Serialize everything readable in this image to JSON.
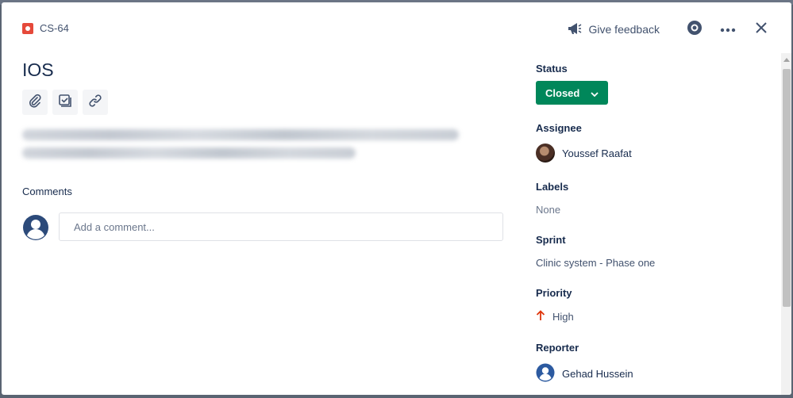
{
  "issue": {
    "key": "CS-64",
    "title": "IOS"
  },
  "header": {
    "feedback_label": "Give feedback"
  },
  "comments": {
    "label": "Comments",
    "placeholder": "Add a comment..."
  },
  "sidebar": {
    "status": {
      "label": "Status",
      "value": "Closed",
      "color": "#00875a"
    },
    "assignee": {
      "label": "Assignee",
      "name": "Youssef Raafat"
    },
    "labels": {
      "label": "Labels",
      "value": "None"
    },
    "sprint": {
      "label": "Sprint",
      "value": "Clinic system - Phase one"
    },
    "priority": {
      "label": "Priority",
      "value": "High",
      "color": "#de350b"
    },
    "reporter": {
      "label": "Reporter",
      "name": "Gehad Hussein"
    }
  },
  "icons": {
    "issue_type": "bug-icon",
    "feedback": "megaphone-icon",
    "watch": "eye-icon",
    "more": "more-icon",
    "close": "close-icon",
    "attach": "paperclip-icon",
    "subtask": "checklist-icon",
    "link": "link-icon",
    "priority": "arrow-up-icon",
    "user": "user-avatar-icon"
  }
}
